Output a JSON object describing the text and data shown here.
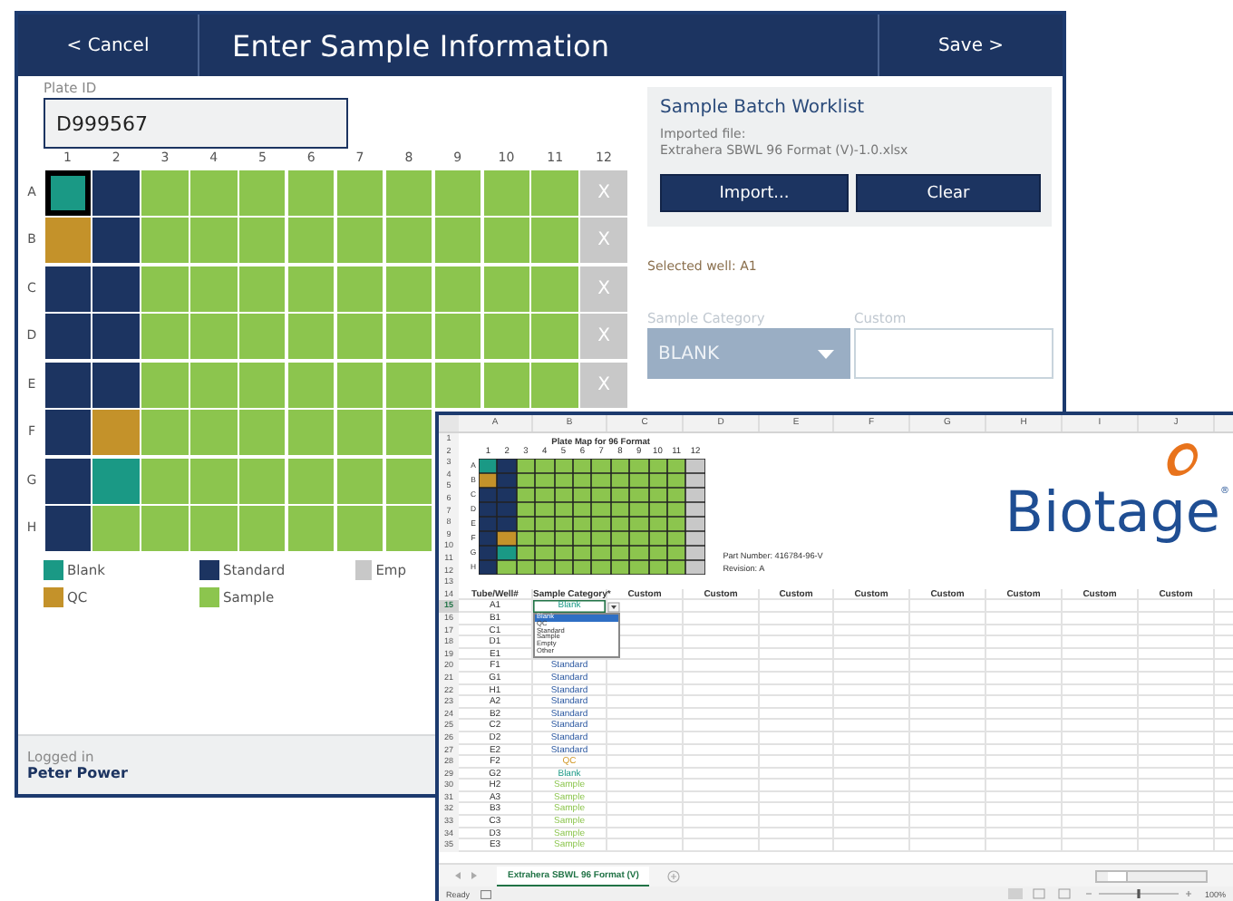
{
  "app": {
    "cancel_button": "< Cancel",
    "title": "Enter Sample Information",
    "save_button": "Save >",
    "plate_id": {
      "label": "Plate ID",
      "value": "D999567"
    },
    "plate": {
      "columns": [
        "1",
        "2",
        "3",
        "4",
        "5",
        "6",
        "7",
        "8",
        "9",
        "10",
        "11",
        "12"
      ],
      "rows": [
        {
          "label": "A",
          "x_label": "X",
          "wells": [
            {
              "kind": "blank",
              "selected": true
            },
            {
              "kind": "standard",
              "selected": false
            },
            {
              "kind": "sample",
              "selected": false
            },
            {
              "kind": "sample",
              "selected": false
            },
            {
              "kind": "sample",
              "selected": false
            },
            {
              "kind": "sample",
              "selected": false
            },
            {
              "kind": "sample",
              "selected": false
            },
            {
              "kind": "sample",
              "selected": false
            },
            {
              "kind": "sample",
              "selected": false
            },
            {
              "kind": "sample",
              "selected": false
            },
            {
              "kind": "sample",
              "selected": false
            },
            {
              "kind": "empty",
              "selected": false
            }
          ]
        },
        {
          "label": "B",
          "x_label": "X",
          "wells": [
            {
              "kind": "qc",
              "selected": false
            },
            {
              "kind": "standard",
              "selected": false
            },
            {
              "kind": "sample",
              "selected": false
            },
            {
              "kind": "sample",
              "selected": false
            },
            {
              "kind": "sample",
              "selected": false
            },
            {
              "kind": "sample",
              "selected": false
            },
            {
              "kind": "sample",
              "selected": false
            },
            {
              "kind": "sample",
              "selected": false
            },
            {
              "kind": "sample",
              "selected": false
            },
            {
              "kind": "sample",
              "selected": false
            },
            {
              "kind": "sample",
              "selected": false
            },
            {
              "kind": "empty",
              "selected": false
            }
          ]
        },
        {
          "label": "C",
          "x_label": "X",
          "wells": [
            {
              "kind": "standard",
              "selected": false
            },
            {
              "kind": "standard",
              "selected": false
            },
            {
              "kind": "sample",
              "selected": false
            },
            {
              "kind": "sample",
              "selected": false
            },
            {
              "kind": "sample",
              "selected": false
            },
            {
              "kind": "sample",
              "selected": false
            },
            {
              "kind": "sample",
              "selected": false
            },
            {
              "kind": "sample",
              "selected": false
            },
            {
              "kind": "sample",
              "selected": false
            },
            {
              "kind": "sample",
              "selected": false
            },
            {
              "kind": "sample",
              "selected": false
            },
            {
              "kind": "empty",
              "selected": false
            }
          ]
        },
        {
          "label": "D",
          "x_label": "X",
          "wells": [
            {
              "kind": "standard",
              "selected": false
            },
            {
              "kind": "standard",
              "selected": false
            },
            {
              "kind": "sample",
              "selected": false
            },
            {
              "kind": "sample",
              "selected": false
            },
            {
              "kind": "sample",
              "selected": false
            },
            {
              "kind": "sample",
              "selected": false
            },
            {
              "kind": "sample",
              "selected": false
            },
            {
              "kind": "sample",
              "selected": false
            },
            {
              "kind": "sample",
              "selected": false
            },
            {
              "kind": "sample",
              "selected": false
            },
            {
              "kind": "sample",
              "selected": false
            },
            {
              "kind": "empty",
              "selected": false
            }
          ]
        },
        {
          "label": "E",
          "x_label": "X",
          "wells": [
            {
              "kind": "standard",
              "selected": false
            },
            {
              "kind": "standard",
              "selected": false
            },
            {
              "kind": "sample",
              "selected": false
            },
            {
              "kind": "sample",
              "selected": false
            },
            {
              "kind": "sample",
              "selected": false
            },
            {
              "kind": "sample",
              "selected": false
            },
            {
              "kind": "sample",
              "selected": false
            },
            {
              "kind": "sample",
              "selected": false
            },
            {
              "kind": "sample",
              "selected": false
            },
            {
              "kind": "sample",
              "selected": false
            },
            {
              "kind": "sample",
              "selected": false
            },
            {
              "kind": "empty",
              "selected": false
            }
          ]
        },
        {
          "label": "F",
          "wells": [
            {
              "kind": "standard",
              "selected": false
            },
            {
              "kind": "qc",
              "selected": false
            },
            {
              "kind": "sample",
              "selected": false
            },
            {
              "kind": "sample",
              "selected": false
            },
            {
              "kind": "sample",
              "selected": false
            },
            {
              "kind": "sample",
              "selected": false
            },
            {
              "kind": "sample",
              "selected": false
            },
            {
              "kind": "sample",
              "selected": false
            }
          ]
        },
        {
          "label": "G",
          "wells": [
            {
              "kind": "standard",
              "selected": false
            },
            {
              "kind": "blank",
              "selected": false
            },
            {
              "kind": "sample",
              "selected": false
            },
            {
              "kind": "sample",
              "selected": false
            },
            {
              "kind": "sample",
              "selected": false
            },
            {
              "kind": "sample",
              "selected": false
            },
            {
              "kind": "sample",
              "selected": false
            },
            {
              "kind": "sample",
              "selected": false
            }
          ]
        },
        {
          "label": "H",
          "wells": [
            {
              "kind": "standard",
              "selected": false
            },
            {
              "kind": "sample",
              "selected": false
            },
            {
              "kind": "sample",
              "selected": false
            },
            {
              "kind": "sample",
              "selected": false
            },
            {
              "kind": "sample",
              "selected": false
            },
            {
              "kind": "sample",
              "selected": false
            },
            {
              "kind": "sample",
              "selected": false
            },
            {
              "kind": "sample",
              "selected": false
            }
          ]
        }
      ]
    },
    "legend": [
      {
        "kind": "blank",
        "label": "Blank"
      },
      {
        "kind": "standard",
        "label": "Standard"
      },
      {
        "kind": "empty",
        "label": "Emp"
      },
      {
        "kind": "qc",
        "label": "QC"
      },
      {
        "kind": "sample",
        "label": "Sample"
      }
    ],
    "worklist": {
      "title": "Sample Batch Worklist",
      "imported_label": "Imported file:",
      "file_name": "Extrahera SBWL 96 Format (V)-1.0.xlsx",
      "import_button": "Import...",
      "clear_button": "Clear"
    },
    "selected_well": "Selected well: A1",
    "sample_category": {
      "label": "Sample Category",
      "value": "BLANK",
      "disabled": true
    },
    "custom": {
      "label": "Custom"
    },
    "footer": {
      "label": "Logged in",
      "user": "Peter Power"
    }
  },
  "sheet": {
    "column_letters": [
      "A",
      "B",
      "C",
      "D",
      "E",
      "F",
      "G",
      "H",
      "I",
      "J"
    ],
    "top_row_numbers": [
      "1",
      "2",
      "3",
      "4",
      "5",
      "6",
      "7",
      "8",
      "9",
      "10",
      "11",
      "12",
      "13"
    ],
    "plate_map": {
      "title": "Plate Map for 96 Format",
      "columns": [
        "1",
        "2",
        "3",
        "4",
        "5",
        "6",
        "7",
        "8",
        "9",
        "10",
        "11",
        "12"
      ],
      "rows": [
        {
          "label": "A",
          "wells": [
            {
              "kind": "blank"
            },
            {
              "kind": "standard"
            },
            {
              "kind": "sample"
            },
            {
              "kind": "sample"
            },
            {
              "kind": "sample"
            },
            {
              "kind": "sample"
            },
            {
              "kind": "sample"
            },
            {
              "kind": "sample"
            },
            {
              "kind": "sample"
            },
            {
              "kind": "sample"
            },
            {
              "kind": "sample"
            },
            {
              "kind": "empty"
            }
          ]
        },
        {
          "label": "B",
          "wells": [
            {
              "kind": "qc"
            },
            {
              "kind": "standard"
            },
            {
              "kind": "sample"
            },
            {
              "kind": "sample"
            },
            {
              "kind": "sample"
            },
            {
              "kind": "sample"
            },
            {
              "kind": "sample"
            },
            {
              "kind": "sample"
            },
            {
              "kind": "sample"
            },
            {
              "kind": "sample"
            },
            {
              "kind": "sample"
            },
            {
              "kind": "empty"
            }
          ]
        },
        {
          "label": "C",
          "wells": [
            {
              "kind": "standard"
            },
            {
              "kind": "standard"
            },
            {
              "kind": "sample"
            },
            {
              "kind": "sample"
            },
            {
              "kind": "sample"
            },
            {
              "kind": "sample"
            },
            {
              "kind": "sample"
            },
            {
              "kind": "sample"
            },
            {
              "kind": "sample"
            },
            {
              "kind": "sample"
            },
            {
              "kind": "sample"
            },
            {
              "kind": "empty"
            }
          ]
        },
        {
          "label": "D",
          "wells": [
            {
              "kind": "standard"
            },
            {
              "kind": "standard"
            },
            {
              "kind": "sample"
            },
            {
              "kind": "sample"
            },
            {
              "kind": "sample"
            },
            {
              "kind": "sample"
            },
            {
              "kind": "sample"
            },
            {
              "kind": "sample"
            },
            {
              "kind": "sample"
            },
            {
              "kind": "sample"
            },
            {
              "kind": "sample"
            },
            {
              "kind": "empty"
            }
          ]
        },
        {
          "label": "E",
          "wells": [
            {
              "kind": "standard"
            },
            {
              "kind": "standard"
            },
            {
              "kind": "sample"
            },
            {
              "kind": "sample"
            },
            {
              "kind": "sample"
            },
            {
              "kind": "sample"
            },
            {
              "kind": "sample"
            },
            {
              "kind": "sample"
            },
            {
              "kind": "sample"
            },
            {
              "kind": "sample"
            },
            {
              "kind": "sample"
            },
            {
              "kind": "empty"
            }
          ]
        },
        {
          "label": "F",
          "wells": [
            {
              "kind": "standard"
            },
            {
              "kind": "qc"
            },
            {
              "kind": "sample"
            },
            {
              "kind": "sample"
            },
            {
              "kind": "sample"
            },
            {
              "kind": "sample"
            },
            {
              "kind": "sample"
            },
            {
              "kind": "sample"
            },
            {
              "kind": "sample"
            },
            {
              "kind": "sample"
            },
            {
              "kind": "sample"
            },
            {
              "kind": "empty"
            }
          ]
        },
        {
          "label": "G",
          "wells": [
            {
              "kind": "standard"
            },
            {
              "kind": "blank"
            },
            {
              "kind": "sample"
            },
            {
              "kind": "sample"
            },
            {
              "kind": "sample"
            },
            {
              "kind": "sample"
            },
            {
              "kind": "sample"
            },
            {
              "kind": "sample"
            },
            {
              "kind": "sample"
            },
            {
              "kind": "sample"
            },
            {
              "kind": "sample"
            },
            {
              "kind": "empty"
            }
          ]
        },
        {
          "label": "H",
          "wells": [
            {
              "kind": "standard"
            },
            {
              "kind": "sample"
            },
            {
              "kind": "sample"
            },
            {
              "kind": "sample"
            },
            {
              "kind": "sample"
            },
            {
              "kind": "sample"
            },
            {
              "kind": "sample"
            },
            {
              "kind": "sample"
            },
            {
              "kind": "sample"
            },
            {
              "kind": "sample"
            },
            {
              "kind": "sample"
            },
            {
              "kind": "empty"
            }
          ]
        }
      ]
    },
    "part_number": "Part Number: 416784-96-V",
    "revision": "Revision: A",
    "logo": {
      "text": "Biotage",
      "mark": "®"
    },
    "header": {
      "number": "14",
      "tube": "Tube/Well#",
      "category": "Sample Category*",
      "customs": [
        "Custom",
        "Custom",
        "Custom",
        "Custom",
        "Custom",
        "Custom",
        "Custom",
        "Custom"
      ]
    },
    "rows": [
      {
        "number": "15",
        "tube": "A1",
        "category": "Blank",
        "kind": "blank",
        "active": true
      },
      {
        "number": "16",
        "tube": "B1",
        "active": false
      },
      {
        "number": "17",
        "tube": "C1",
        "active": false
      },
      {
        "number": "18",
        "tube": "D1",
        "active": false
      },
      {
        "number": "19",
        "tube": "E1",
        "active": false
      },
      {
        "number": "20",
        "tube": "F1",
        "category": "Standard",
        "kind": "standard",
        "active": false
      },
      {
        "number": "21",
        "tube": "G1",
        "category": "Standard",
        "kind": "standard",
        "active": false
      },
      {
        "number": "22",
        "tube": "H1",
        "category": "Standard",
        "kind": "standard",
        "active": false
      },
      {
        "number": "23",
        "tube": "A2",
        "category": "Standard",
        "kind": "standard",
        "active": false
      },
      {
        "number": "24",
        "tube": "B2",
        "category": "Standard",
        "kind": "standard",
        "active": false
      },
      {
        "number": "25",
        "tube": "C2",
        "category": "Standard",
        "kind": "standard",
        "active": false
      },
      {
        "number": "26",
        "tube": "D2",
        "category": "Standard",
        "kind": "standard",
        "active": false
      },
      {
        "number": "27",
        "tube": "E2",
        "category": "Standard",
        "kind": "standard",
        "active": false
      },
      {
        "number": "28",
        "tube": "F2",
        "category": "QC",
        "kind": "qc",
        "active": false
      },
      {
        "number": "29",
        "tube": "G2",
        "category": "Blank",
        "kind": "blank",
        "active": false
      },
      {
        "number": "30",
        "tube": "H2",
        "category": "Sample",
        "kind": "sample",
        "active": false
      },
      {
        "number": "31",
        "tube": "A3",
        "category": "Sample",
        "kind": "sample",
        "active": false
      },
      {
        "number": "32",
        "tube": "B3",
        "category": "Sample",
        "kind": "sample",
        "active": false
      },
      {
        "number": "33",
        "tube": "C3",
        "category": "Sample",
        "kind": "sample",
        "active": false
      },
      {
        "number": "34",
        "tube": "D3",
        "category": "Sample",
        "kind": "sample",
        "active": false
      },
      {
        "number": "35",
        "tube": "E3",
        "category": "Sample",
        "kind": "sample",
        "active": false
      }
    ],
    "dropdown": [
      {
        "label": "Blank",
        "selected": true
      },
      {
        "label": "QC",
        "selected": false
      },
      {
        "label": "Standard",
        "selected": false
      },
      {
        "label": "Sample",
        "selected": false
      },
      {
        "label": "Empty",
        "selected": false
      },
      {
        "label": "Other",
        "selected": false
      }
    ],
    "sheet_tab": {
      "label": "Extrahera SBWL 96 Format (V)",
      "selected": true
    },
    "status": "Ready",
    "zoom_slider": {
      "level": 0.5
    },
    "zoom": "100%"
  }
}
